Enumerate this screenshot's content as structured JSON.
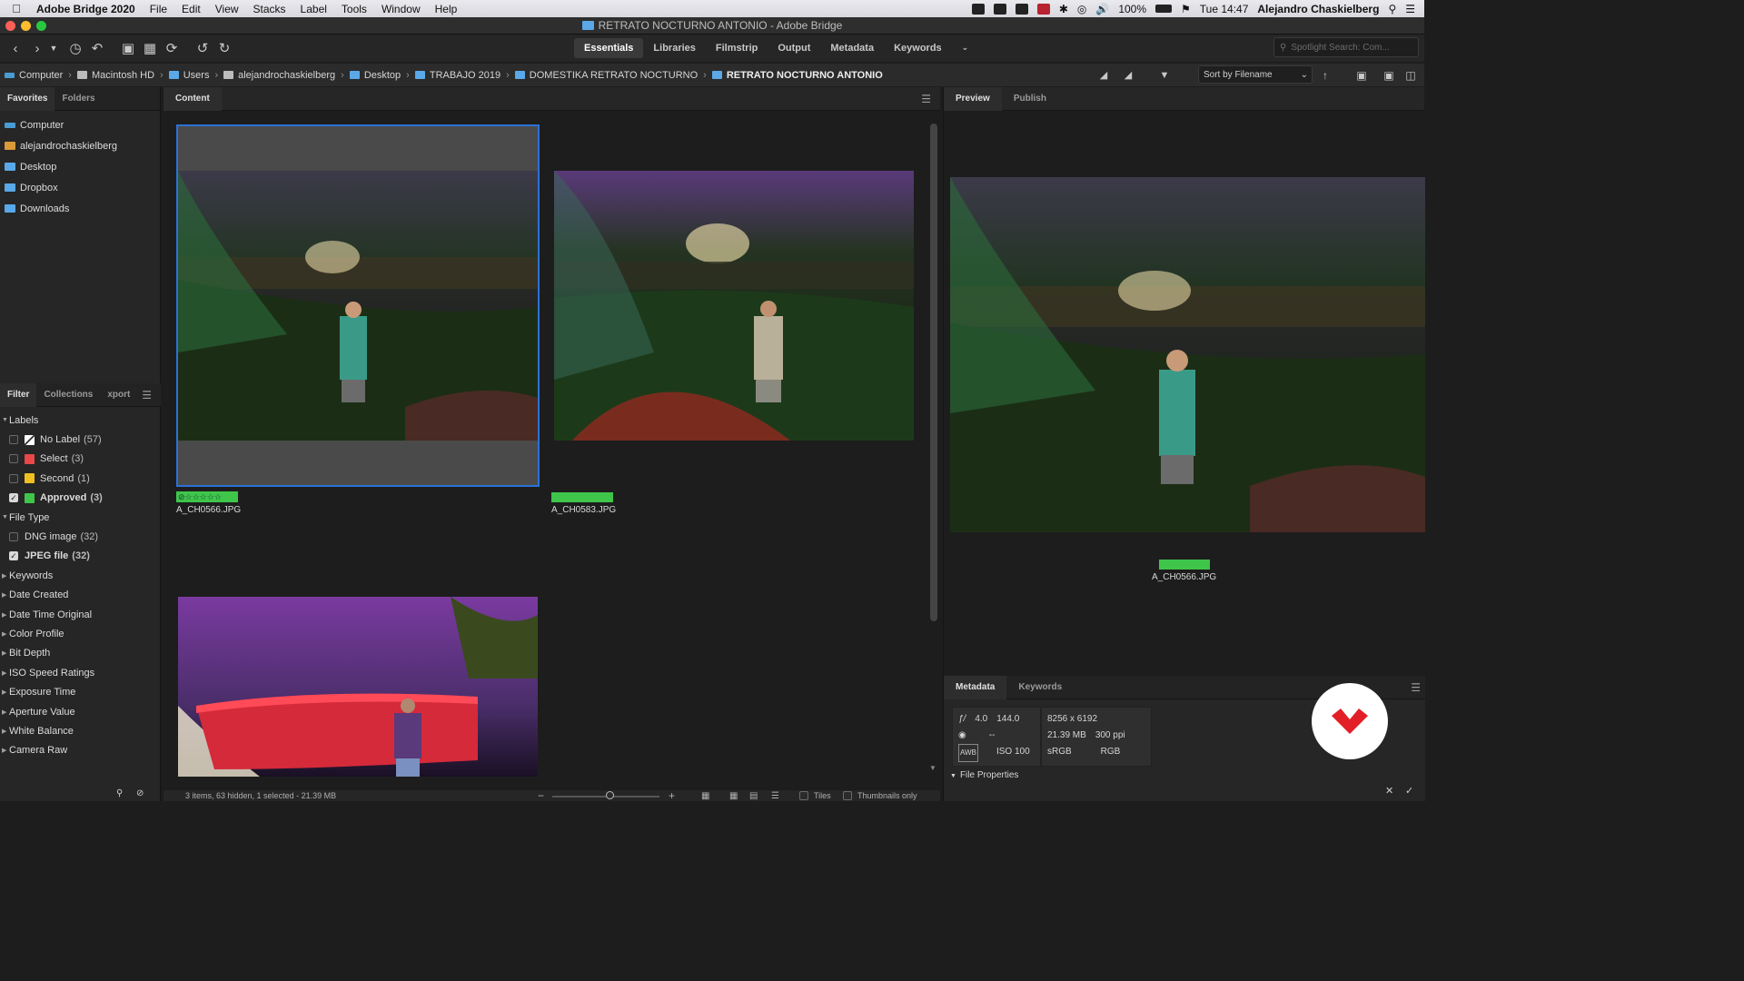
{
  "menubar": {
    "app": "Adobe Bridge 2020",
    "menus": [
      "File",
      "Edit",
      "View",
      "Stacks",
      "Label",
      "Tools",
      "Window",
      "Help"
    ],
    "battery": "100%",
    "clock": "Tue 14:47",
    "user": "Alejandro Chaskielberg"
  },
  "window": {
    "title": "RETRATO NOCTURNO ANTONIO - Adobe Bridge"
  },
  "toolbar": {
    "workspaces": [
      "Essentials",
      "Libraries",
      "Filmstrip",
      "Output",
      "Metadata",
      "Keywords"
    ],
    "active_workspace": "Essentials",
    "search_placeholder": "Spotlight Search: Com..."
  },
  "path": {
    "crumbs": [
      "Computer",
      "Macintosh HD",
      "Users",
      "alejandrochaskielberg",
      "Desktop",
      "TRABAJO 2019",
      "DOMESTIKA RETRATO NOCTURNO",
      "RETRATO NOCTURNO ANTONIO"
    ],
    "sort_label": "Sort by Filename"
  },
  "left": {
    "tabs": [
      "Favorites",
      "Folders"
    ],
    "favorites": [
      "Computer",
      "alejandrochaskielberg",
      "Desktop",
      "Dropbox",
      "Downloads"
    ],
    "filter_tabs": [
      "Filter",
      "Collections",
      "xport"
    ],
    "labels_title": "Labels",
    "labels": [
      {
        "name": "No Label",
        "count": "(57)",
        "color": "#ffffff",
        "checked": false
      },
      {
        "name": "Select",
        "count": "(3)",
        "color": "#e84848",
        "checked": false
      },
      {
        "name": "Second",
        "count": "(1)",
        "color": "#f0c020",
        "checked": false
      },
      {
        "name": "Approved",
        "count": "(3)",
        "color": "#3fc54a",
        "checked": true
      }
    ],
    "filetype_title": "File Type",
    "filetypes": [
      {
        "name": "DNG image",
        "count": "(32)",
        "checked": false
      },
      {
        "name": "JPEG file",
        "count": "(32)",
        "checked": true
      }
    ],
    "sections": [
      "Keywords",
      "Date Created",
      "Date Time Original",
      "Color Profile",
      "Bit Depth",
      "ISO Speed Ratings",
      "Exposure Time",
      "Aperture Value",
      "White Balance",
      "Camera Raw"
    ]
  },
  "content": {
    "tab": "Content",
    "items": [
      {
        "name": "A_CH0566.JPG",
        "selected": true
      },
      {
        "name": "A_CH0583.JPG",
        "selected": false
      },
      {
        "name": "",
        "selected": false
      }
    ],
    "status": "3 items, 63 hidden, 1 selected - 21.39 MB",
    "view_options": [
      "Tiles",
      "Thumbnails only"
    ]
  },
  "preview": {
    "tabs": [
      "Preview",
      "Publish"
    ],
    "filename": "A_CH0566.JPG"
  },
  "metadata": {
    "tabs": [
      "Metadata",
      "Keywords"
    ],
    "aperture": "4.0",
    "shutter": "144.0",
    "dimensions": "8256 x 6192",
    "metering": "--",
    "size": "21.39 MB",
    "resolution": "300 ppi",
    "iso": "ISO 100",
    "colorspace": "sRGB",
    "mode": "RGB",
    "file_properties": "File Properties"
  },
  "colors": {
    "accent": "#2b72d6",
    "approved": "#3fc54a"
  }
}
